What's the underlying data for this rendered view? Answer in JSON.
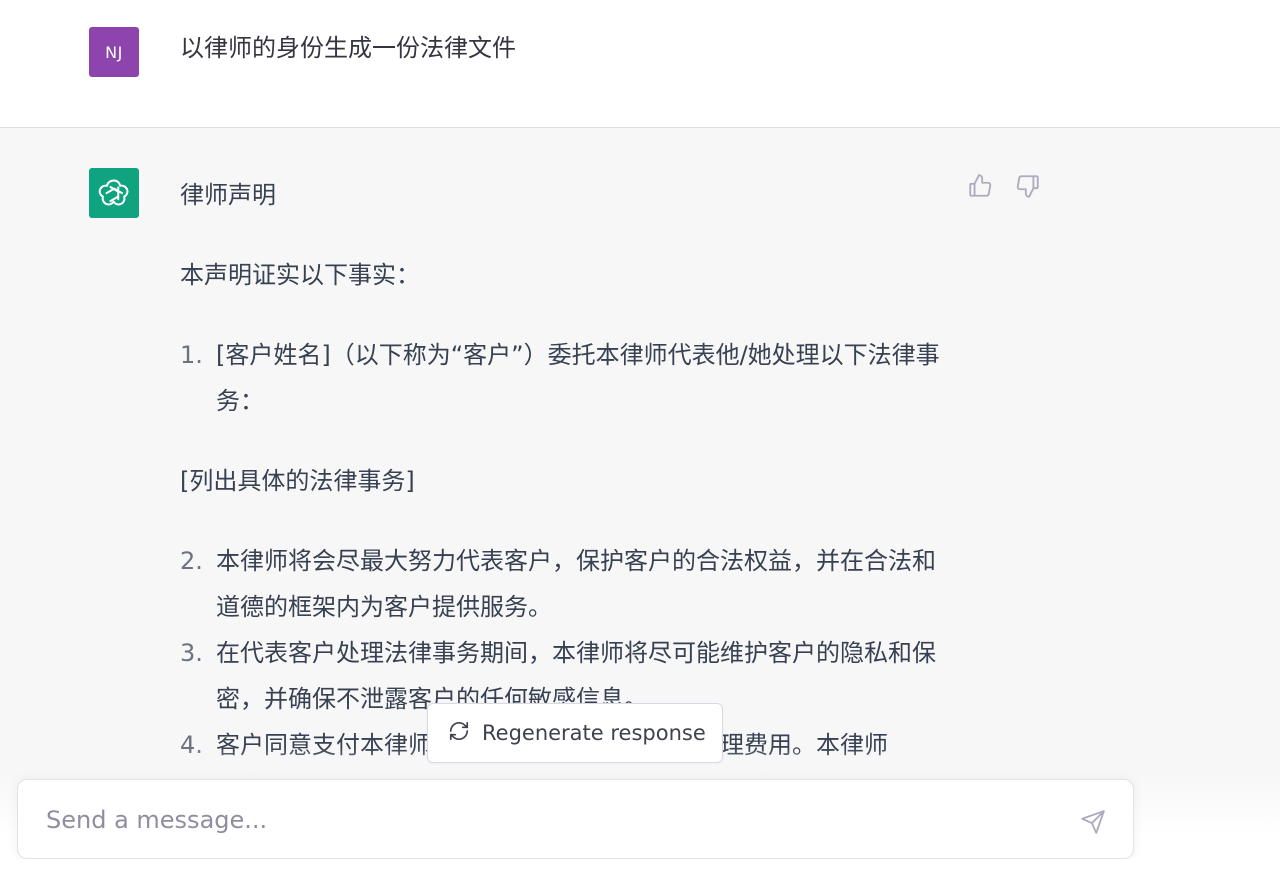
{
  "user": {
    "initials": "NJ",
    "message": "以律师的身份生成一份法律文件"
  },
  "assistant": {
    "title": "律师声明",
    "intro": "本声明证实以下事实：",
    "items": [
      {
        "num": "1.",
        "text": "[客户姓名]（以下称为“客户”）委托本律师代表他/她处理以下法律事务："
      },
      {
        "num": "2.",
        "text": "本律师将会尽最大努力代表客户，保护客户的合法权益，并在合法和道德的框架内为客户提供服务。"
      },
      {
        "num": "3.",
        "text": "在代表客户处理法律事务期间，本律师将尽可能维护客户的隐私和保密，并确保不泄露客户的任何敏感信息。"
      },
      {
        "num": "4.",
        "text": "客户同意支付本律师为处理法律事务所产生的合理费用。本律师"
      }
    ],
    "bracket": "[列出具体的法律事务]"
  },
  "regenerate": {
    "label": "Regenerate response"
  },
  "composer": {
    "placeholder": "Send a message..."
  },
  "colors": {
    "user_avatar": "#8e44ad",
    "bot_avatar": "#10a37f"
  }
}
